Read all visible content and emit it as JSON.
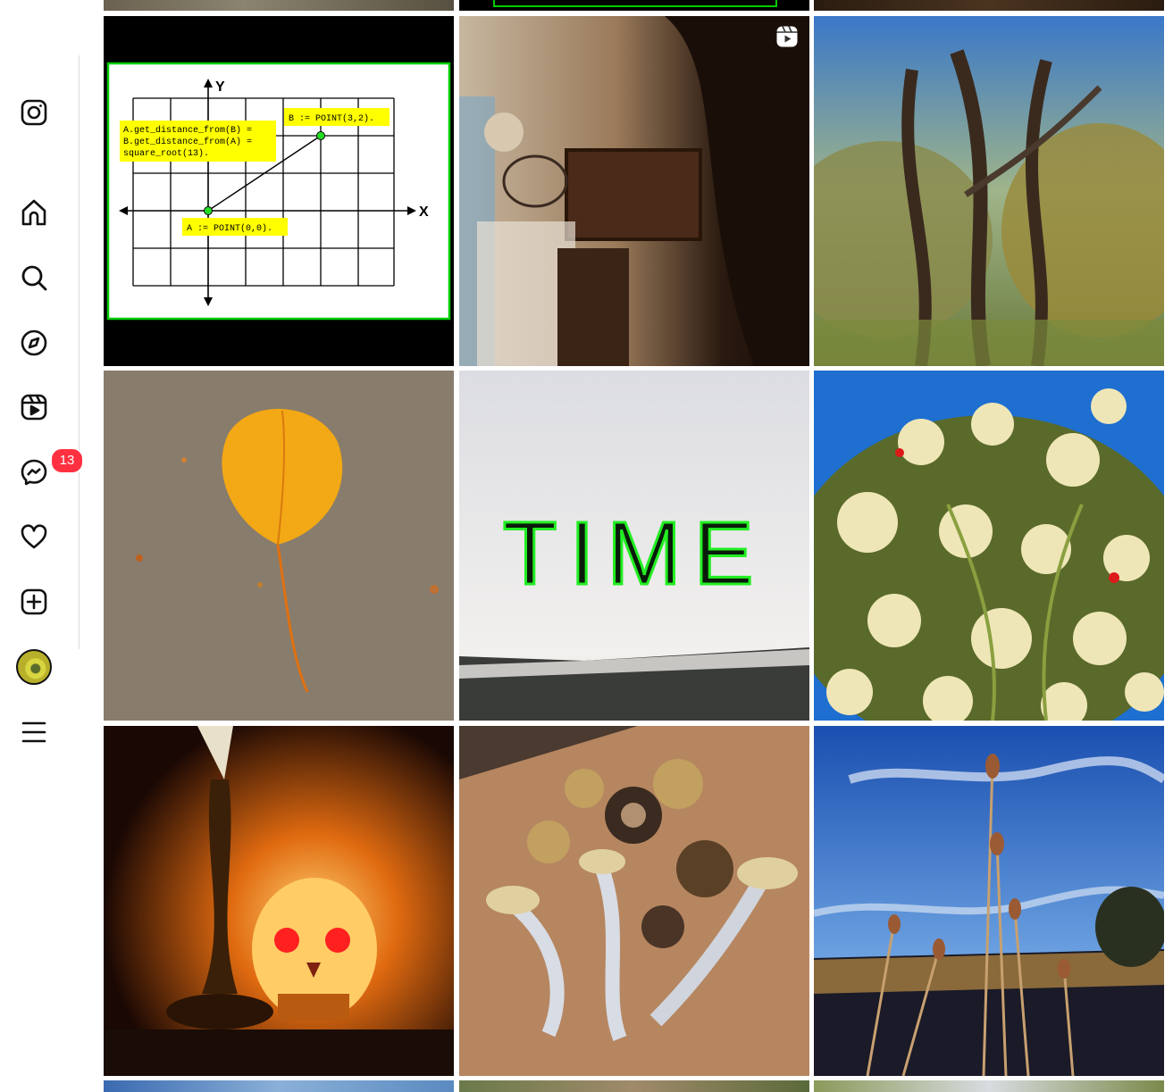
{
  "sidebar": {
    "nav": [
      {
        "name": "instagram-logo",
        "icon": "instagram-icon"
      },
      {
        "name": "home",
        "icon": "home-icon"
      },
      {
        "name": "search",
        "icon": "search-icon"
      },
      {
        "name": "explore",
        "icon": "compass-icon"
      },
      {
        "name": "reels",
        "icon": "reels-icon"
      },
      {
        "name": "messages",
        "icon": "messenger-icon",
        "badge": "13"
      },
      {
        "name": "notifications",
        "icon": "heart-icon"
      },
      {
        "name": "create",
        "icon": "plus-square-icon"
      },
      {
        "name": "profile",
        "icon": "avatar"
      },
      {
        "name": "more",
        "icon": "menu-icon"
      }
    ],
    "badge_color": "#ff3040"
  },
  "grid": {
    "posts": [
      {
        "subject": "coordinate-diagram",
        "is_reel": false,
        "diagram": {
          "y_label": "Y",
          "x_label": "X",
          "note_distance_1": "A.get_distance_from(B) =",
          "note_distance_2": "B.get_distance_from(A) =",
          "note_distance_3": "square_root(13).",
          "point_b": "B := POINT(3,2).",
          "point_a": "A := POINT(0,0)."
        },
        "colors": {
          "frame": "#00cc00",
          "note": "#ffff00",
          "background": "#000000"
        }
      },
      {
        "subject": "dim-room-reel",
        "is_reel": true
      },
      {
        "subject": "oak-trees"
      },
      {
        "subject": "yellow-leaf"
      },
      {
        "subject": "time-sign",
        "sign_text": "TIME",
        "colors": {
          "glow": "#22ee22"
        }
      },
      {
        "subject": "white-flowers-bush"
      },
      {
        "subject": "glowing-skull-lamp"
      },
      {
        "subject": "dried-mushrooms"
      },
      {
        "subject": "teasel-plants-sky"
      }
    ]
  }
}
